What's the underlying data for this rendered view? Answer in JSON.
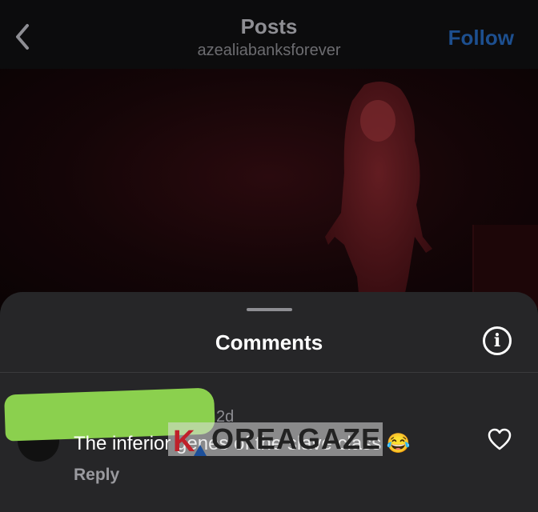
{
  "header": {
    "title": "Posts",
    "username": "azealiabanksforever",
    "follow_label": "Follow",
    "back_icon": "chevron-left-icon"
  },
  "media": {
    "description_icon": "video-frame"
  },
  "comments_sheet": {
    "title": "Comments",
    "info_icon": "info-icon",
    "info_glyph": "i",
    "comment": {
      "time": "2d",
      "text": "The inferior genes of the slave class 😂",
      "reply_label": "Reply",
      "like_icon": "heart-outline-icon"
    }
  },
  "watermark": {
    "text": "OREAGAZE",
    "logo_letter": "K"
  },
  "colors": {
    "follow_blue": "#1d4f8f",
    "sheet_bg": "#262628",
    "redaction_green": "#8bd04e"
  }
}
